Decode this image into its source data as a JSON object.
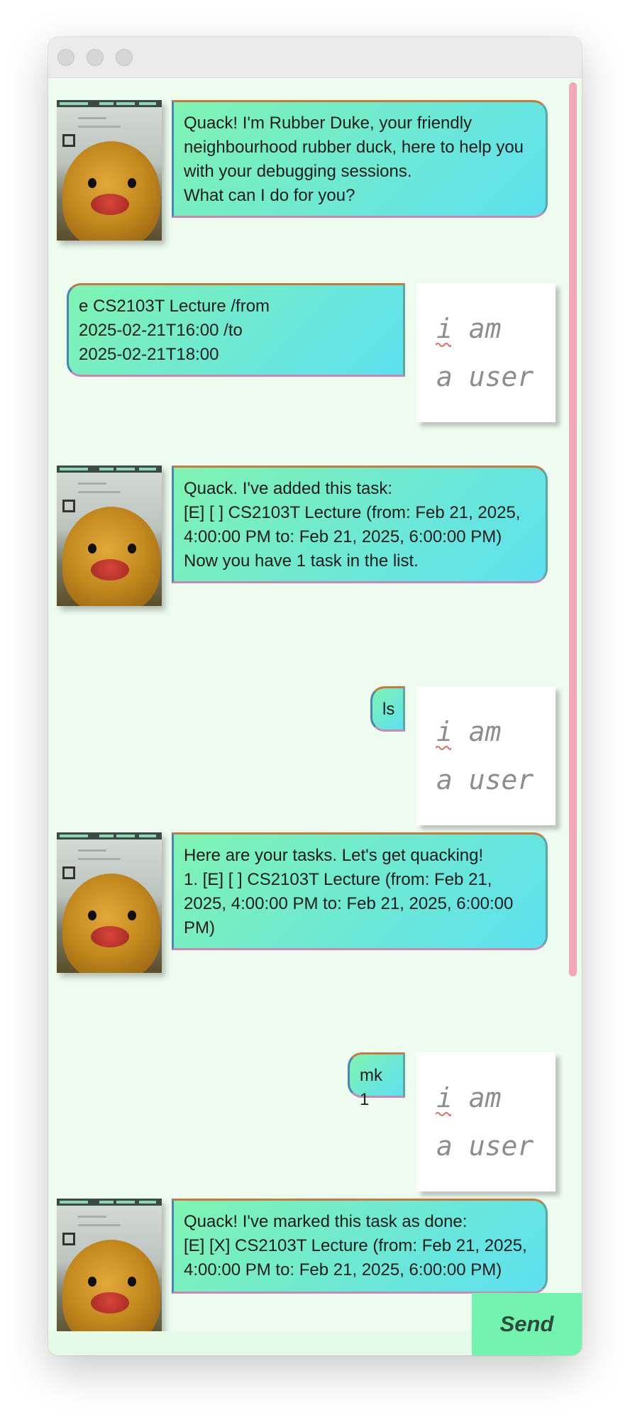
{
  "window": {
    "traffic_lights": [
      "close-button",
      "minimize-button",
      "zoom-button"
    ]
  },
  "messages": [
    {
      "sender": "duke",
      "avatar_icon": "rubber-duck-avatar",
      "text": "Quack! I'm Rubber Duke, your friendly\nneighbourhood rubber duck, here to help you\nwith your debugging sessions.\nWhat can I do for you?"
    },
    {
      "sender": "user",
      "avatar_text_line1": "i am",
      "avatar_text_line2": "a user",
      "text": "e CS2103T Lecture /from\n2025-02-21T16:00 /to\n2025-02-21T18:00"
    },
    {
      "sender": "duke",
      "avatar_icon": "rubber-duck-avatar",
      "text": "Quack. I've added this task:\n[E] [ ] CS2103T Lecture (from: Feb 21, 2025,\n4:00:00 PM to: Feb 21, 2025, 6:00:00 PM)\nNow you have 1 task in the list."
    },
    {
      "sender": "user",
      "avatar_text_line1": "i am",
      "avatar_text_line2": "a user",
      "text": "ls"
    },
    {
      "sender": "duke",
      "avatar_icon": "rubber-duck-avatar",
      "text": "Here are your tasks. Let's get quacking!\n1. [E] [ ] CS2103T Lecture (from: Feb 21,\n2025, 4:00:00 PM to: Feb 21, 2025, 6:00:00\nPM)"
    },
    {
      "sender": "user",
      "avatar_text_line1": "i am",
      "avatar_text_line2": "a user",
      "text": "mk 1"
    },
    {
      "sender": "duke",
      "avatar_icon": "rubber-duck-avatar",
      "text": "Quack! I've marked this task as done:\n[E] [X] CS2103T Lecture (from: Feb 21, 2025,\n4:00:00 PM to: Feb 21, 2025, 6:00:00 PM)"
    }
  ],
  "input": {
    "value": "",
    "placeholder": ""
  },
  "send_button": {
    "label": "Send"
  },
  "colors": {
    "background": "#eefcf0",
    "bubble_gradient_start": "#80f3b2",
    "bubble_gradient_end": "#5de0f0",
    "send_button": "#72f4ae",
    "scrollbar": "#f2a8b6"
  }
}
